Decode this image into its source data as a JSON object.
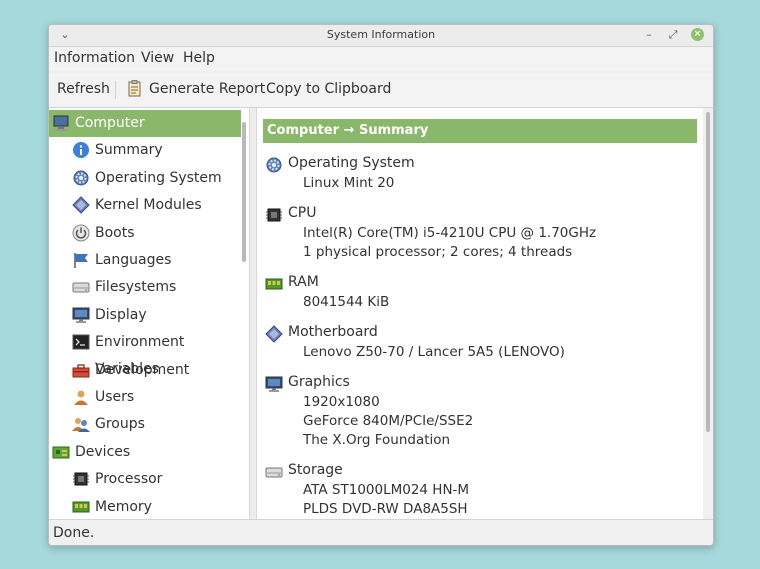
{
  "window": {
    "title": "System Information",
    "menu_glyph": "⌄",
    "minimize_glyph": "–",
    "maximize_glyph": "⤢",
    "close_glyph": "×"
  },
  "menubar": [
    "Information",
    "View",
    "Help"
  ],
  "toolbar": {
    "refresh": "Refresh",
    "generate_report": "Generate Report",
    "copy": "Copy to Clipboard"
  },
  "sidebar": {
    "items": [
      {
        "label": "Computer",
        "icon": "computer-icon",
        "level": 0,
        "selected": true
      },
      {
        "label": "Summary",
        "icon": "info-icon",
        "level": 1
      },
      {
        "label": "Operating System",
        "icon": "gear-icon",
        "level": 1
      },
      {
        "label": "Kernel Modules",
        "icon": "module-icon",
        "level": 1
      },
      {
        "label": "Boots",
        "icon": "power-icon",
        "level": 1
      },
      {
        "label": "Languages",
        "icon": "flag-icon",
        "level": 1
      },
      {
        "label": "Filesystems",
        "icon": "drive-icon",
        "level": 1
      },
      {
        "label": "Display",
        "icon": "monitor-icon",
        "level": 1
      },
      {
        "label": "Environment Variables",
        "icon": "terminal-icon",
        "level": 1
      },
      {
        "label": "Development",
        "icon": "toolbox-icon",
        "level": 1
      },
      {
        "label": "Users",
        "icon": "user-icon",
        "level": 1
      },
      {
        "label": "Groups",
        "icon": "group-icon",
        "level": 1
      },
      {
        "label": "Devices",
        "icon": "board-icon",
        "level": 0
      },
      {
        "label": "Processor",
        "icon": "chip-icon",
        "level": 1
      },
      {
        "label": "Memory",
        "icon": "ram-icon",
        "level": 1
      }
    ]
  },
  "content": {
    "header": "Computer → Summary",
    "sections": [
      {
        "title": "Operating System",
        "icon": "gear-icon",
        "lines": [
          "Linux Mint 20"
        ]
      },
      {
        "title": "CPU",
        "icon": "chip-icon",
        "lines": [
          "Intel(R) Core(TM) i5-4210U CPU @ 1.70GHz",
          "1 physical processor; 2 cores; 4 threads"
        ]
      },
      {
        "title": "RAM",
        "icon": "ram-icon",
        "lines": [
          "8041544 KiB"
        ]
      },
      {
        "title": "Motherboard",
        "icon": "module-icon",
        "lines": [
          "Lenovo Z50-70 / Lancer 5A5 (LENOVO)"
        ]
      },
      {
        "title": "Graphics",
        "icon": "monitor-icon",
        "lines": [
          "1920x1080",
          "GeForce 840M/PCIe/SSE2",
          "The X.Org Foundation"
        ]
      },
      {
        "title": "Storage",
        "icon": "drive-icon",
        "lines": [
          "ATA ST1000LM024 HN-M",
          "PLDS DVD-RW DA8A5SH"
        ]
      }
    ]
  },
  "status": "Done.",
  "colors": {
    "accent": "#8ab86a",
    "background": "#a6d9db"
  }
}
